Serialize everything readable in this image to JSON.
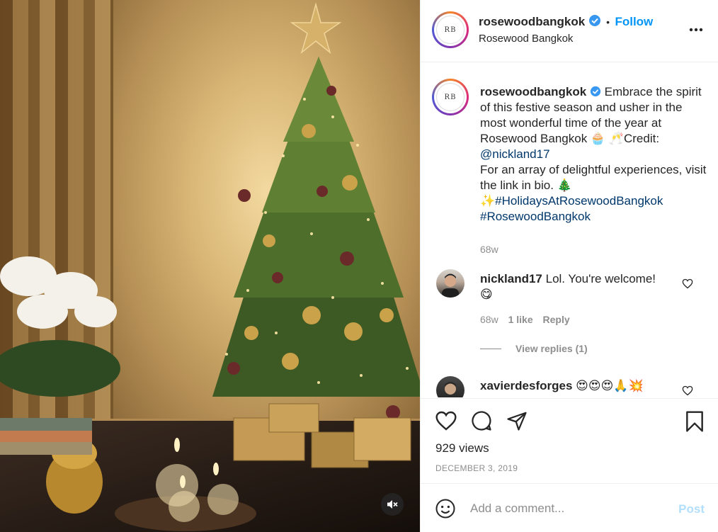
{
  "post": {
    "username": "rosewoodbangkok",
    "follow_label": "Follow",
    "separator": "•",
    "location": "Rosewood Bangkok",
    "avatar_logo_text": "RB",
    "more_icon": "more-horizontal-icon"
  },
  "caption": {
    "username": "rosewoodbangkok",
    "line1": "Embrace the spirit of this festive season and usher in the most wonderful time of the year at Rosewood Bangkok 🧁 🥂Credit: ",
    "mention": "@nickland17",
    "line2": "For an array of delightful experiences, visit the link in bio. 🎄",
    "sparkle": "✨",
    "hashtag1": "#HolidaysAtRosewoodBangkok",
    "hashtag2": "#RosewoodBangkok",
    "time": "68w"
  },
  "comments": [
    {
      "username": "nickland17",
      "text": "Lol. You're welcome!",
      "emoji": "😋",
      "time": "68w",
      "likes": "1 like",
      "reply_label": "Reply",
      "view_replies": "View replies (1)"
    },
    {
      "username": "xavierdesforges",
      "text": "😍😍😍🙏💥"
    }
  ],
  "actions": {
    "views": "929 views",
    "date": "DECEMBER 3, 2019"
  },
  "add_comment": {
    "placeholder": "Add a comment...",
    "post_label": "Post"
  },
  "colors": {
    "accent": "#0095f6",
    "link": "#00376b",
    "muted": "#8e8e8e",
    "post_disabled": "#b2dffc",
    "verified": "#3897f0"
  }
}
